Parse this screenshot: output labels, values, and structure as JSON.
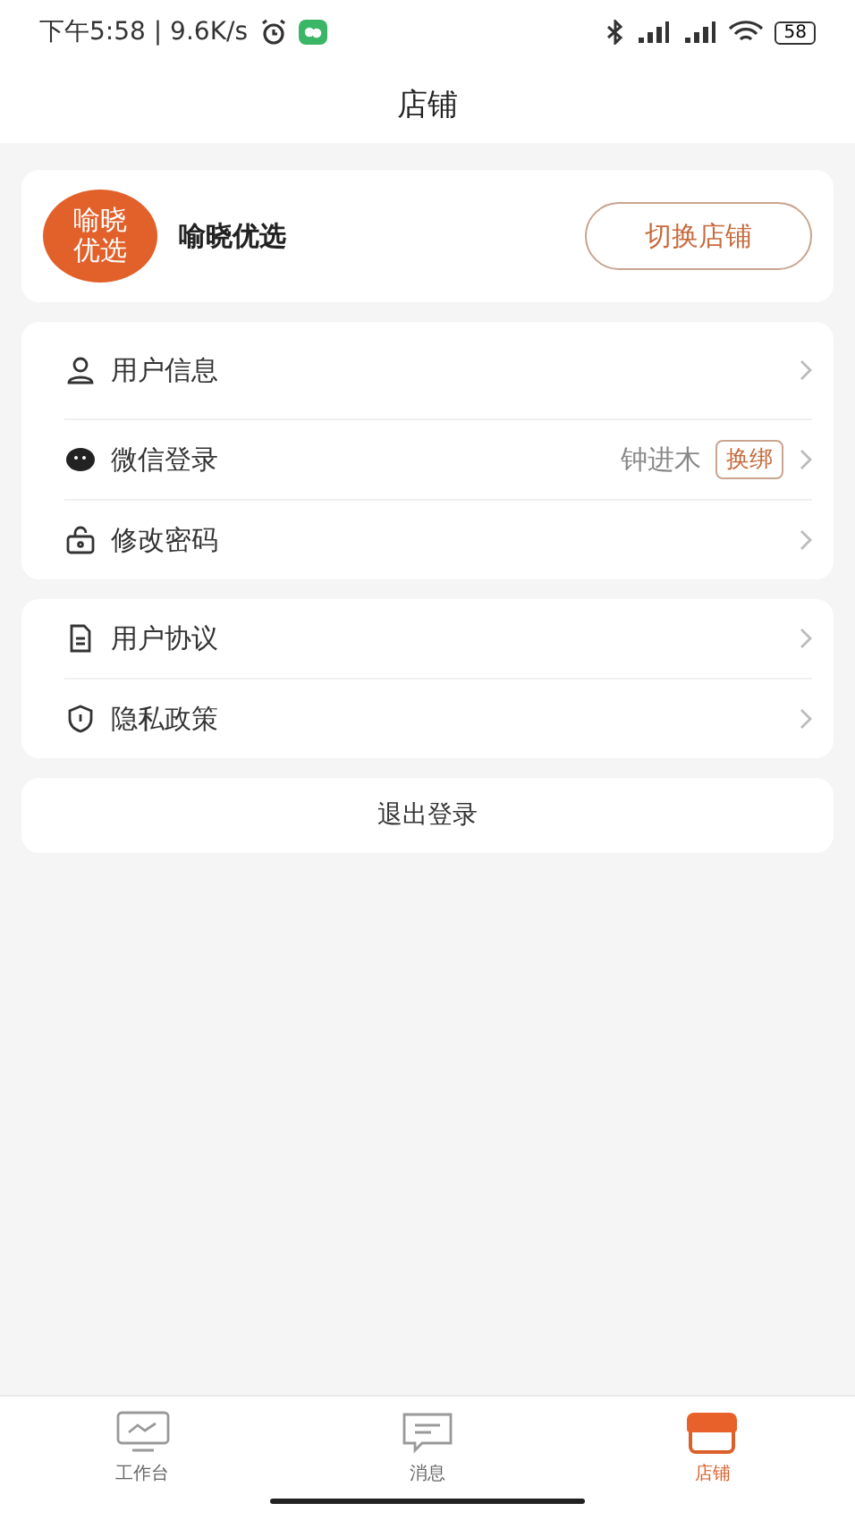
{
  "status_bar": {
    "time": "下午5:58 | 9.6K/s",
    "battery": "58"
  },
  "header": {
    "title": "店铺"
  },
  "store": {
    "logo_lines": [
      "喻晓",
      "优选"
    ],
    "name": "喻晓优选",
    "switch_button": "切换店铺"
  },
  "menu_groups": [
    {
      "items": [
        {
          "kind": "user",
          "label": "用户信息"
        },
        {
          "kind": "wechat",
          "label": "微信登录",
          "value": "钟进木",
          "badge": "换绑"
        },
        {
          "kind": "lock",
          "label": "修改密码"
        }
      ]
    },
    {
      "items": [
        {
          "kind": "document",
          "label": "用户协议"
        },
        {
          "kind": "shield",
          "label": "隐私政策"
        }
      ]
    }
  ],
  "logout_button": "退出登录",
  "tab_bar": [
    {
      "kind": "monitor",
      "label": "工作台",
      "selected": false
    },
    {
      "kind": "chat",
      "label": "消息",
      "selected": false
    },
    {
      "kind": "store",
      "label": "店铺",
      "selected": true
    }
  ]
}
